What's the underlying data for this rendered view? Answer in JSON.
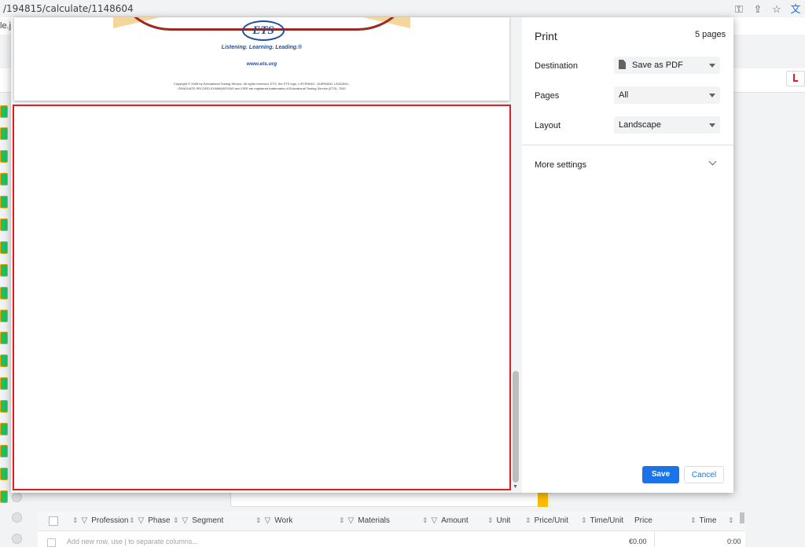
{
  "browser": {
    "url": "/194815/calculate/1148604",
    "bookmark_fragment": "le.js",
    "icons": [
      "key-icon",
      "share-icon",
      "star-icon",
      "translate-icon"
    ]
  },
  "print_dialog": {
    "title": "Print",
    "page_count": "5 pages",
    "destination_label": "Destination",
    "destination_value": "Save as PDF",
    "pages_label": "Pages",
    "pages_value": "All",
    "layout_label": "Layout",
    "layout_value": "Landscape",
    "more_settings": "More settings",
    "save_button": "Save",
    "cancel_button": "Cancel"
  },
  "preview": {
    "logo_text": "ETS",
    "tagline": "Listening. Learning. Leading.®",
    "website": "www.ets.org",
    "copyright_line1": "Copyright © 2008 by Educational Testing Service. All rights reserved. ETS, the ETS logo, LISTENING. LEARNING. LEADING.,",
    "copyright_line2": "GRADUATE RECORD EXAMINATIONS and GRE are registered trademarks of Educational Testing Service (ETS). 7043"
  },
  "background_grid": {
    "columns": [
      "Profession",
      "Phase",
      "Segment",
      "Work",
      "Materials",
      "Amount",
      "Unit",
      "Price/Unit",
      "Time/Unit",
      "Price",
      "Time"
    ],
    "new_row_placeholder": "Add new row, use | to separate columns...",
    "row_price": "€0.00",
    "row_time": "0:00"
  },
  "colors": {
    "accent": "#1a73e8",
    "preview_border": "#e31b23",
    "ets_blue": "#1d4f9c"
  }
}
